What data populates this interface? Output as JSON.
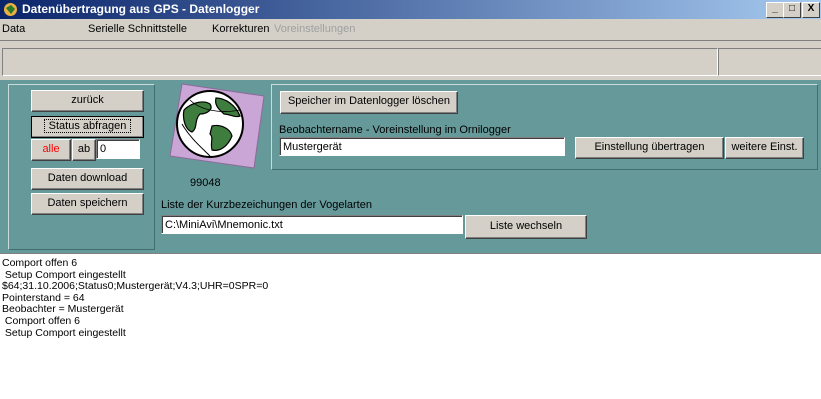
{
  "window": {
    "title": "Datenübertragung aus GPS - Datenlogger",
    "controls": [
      "_",
      "□",
      "X"
    ]
  },
  "menu": {
    "items": [
      {
        "label": "Data",
        "enabled": true
      },
      {
        "label": "Serielle Schnittstelle",
        "enabled": true
      },
      {
        "label": "Korrekturen",
        "enabled": true
      },
      {
        "label": "Voreinstellungen",
        "enabled": false
      }
    ]
  },
  "left": {
    "back_label": "zurück",
    "status_label": "Status abfragen",
    "alle_label": "alle",
    "ab_label": "ab",
    "ab_value": "0",
    "download_label": "Daten download",
    "save_label": "Daten speichern"
  },
  "logger": {
    "id_value": "99048",
    "clear_label": "Speicher im Datenlogger löschen",
    "observer_caption": "Beobachtername - Voreinstellung im Ornilogger",
    "observer_value": "Mustergerät",
    "transfer_label": "Einstellung übertragen",
    "more_label": "weitere Einst."
  },
  "species": {
    "caption": "Liste der Kurzbezeichungen der Vogelarten",
    "path_value": "C:\\MiniAvi\\Mnemonic.txt",
    "change_label": "Liste wechseln"
  },
  "log": {
    "lines": [
      "Comport offen 6",
      " Setup Comport eingestellt",
      "$64;31.10.2006;Status0;Mustergerät;V4.3;UHR=0SPR=0",
      "Pointerstand = 64",
      "Beobachter = Mustergerät",
      " Comport offen 6",
      " Setup Comport eingestellt"
    ]
  },
  "colors": {
    "panel": "#66999a",
    "titlebar_start": "#0a246a",
    "titlebar_end": "#a6caf0",
    "alle_text": "#ff0000"
  }
}
